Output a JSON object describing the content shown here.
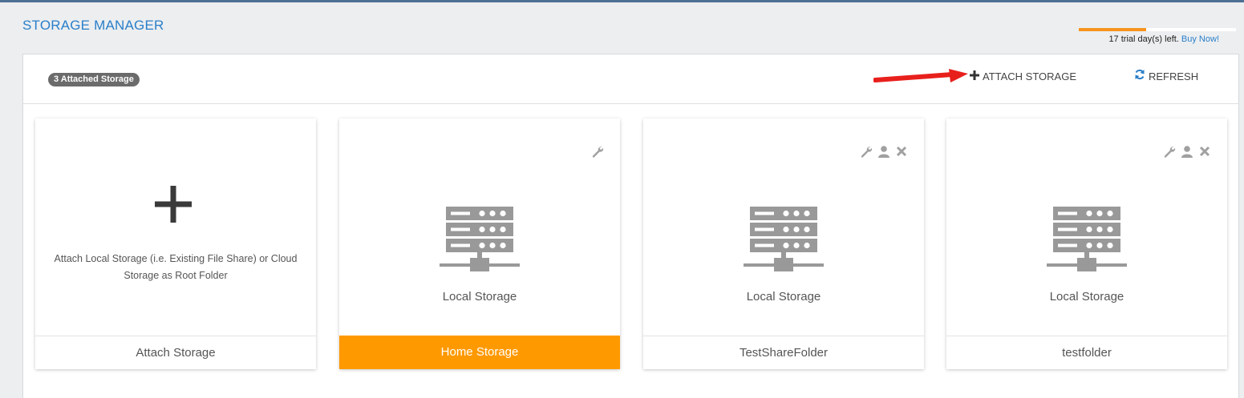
{
  "header": {
    "title": "STORAGE MANAGER",
    "trial_text": "17 trial day(s) left.",
    "buy_now": "Buy Now!",
    "trial_progress": 0.43
  },
  "toolbar": {
    "badge": "3 Attached Storage",
    "attach_label": "ATTACH STORAGE",
    "refresh_label": "REFRESH"
  },
  "cards": [
    {
      "footer": "Attach Storage",
      "description": "Attach Local Storage (i.e. Existing File Share) or Cloud Storage as Root Folder"
    },
    {
      "label": "Local Storage",
      "footer": "Home Storage",
      "active": true,
      "tools": [
        "wrench-icon"
      ]
    },
    {
      "label": "Local Storage",
      "footer": "TestShareFolder",
      "tools": [
        "wrench-icon",
        "user-icon",
        "close-icon"
      ]
    },
    {
      "label": "Local Storage",
      "footer": "testfolder",
      "tools": [
        "wrench-icon",
        "user-icon",
        "close-icon"
      ]
    }
  ],
  "colors": {
    "accent": "#2a7fc9",
    "active_footer": "#ff9900",
    "trial_bar": "#f7941d",
    "arrow": "#e8201c"
  }
}
